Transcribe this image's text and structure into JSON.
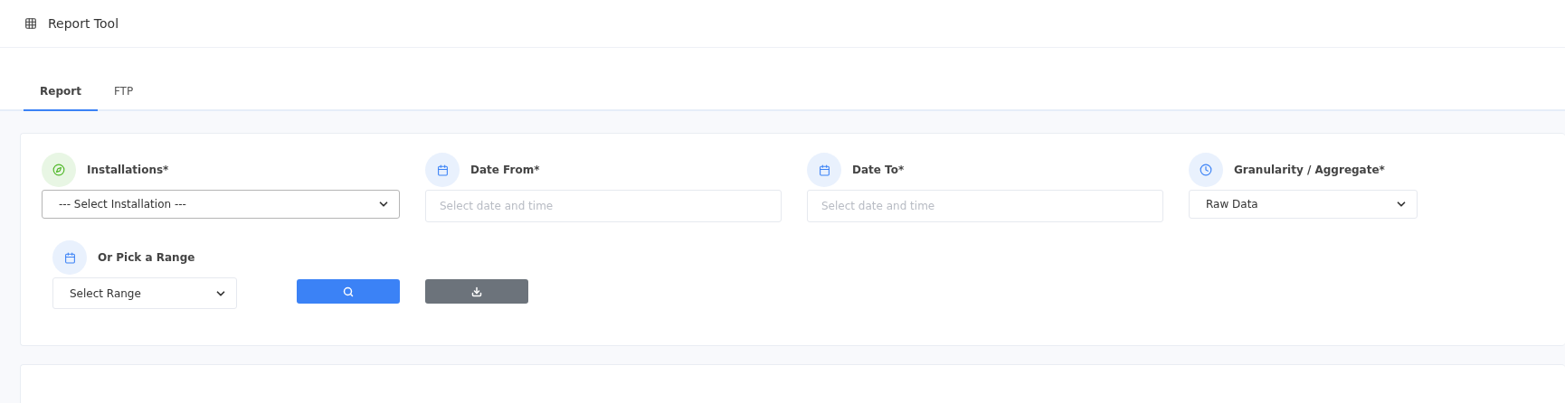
{
  "header": {
    "title": "Report Tool"
  },
  "tabs": [
    {
      "label": "Report",
      "selected": true
    },
    {
      "label": "FTP",
      "selected": false
    }
  ],
  "fields": [
    {
      "kind": "installation",
      "label": "Installations*",
      "value": "--- Select Installation ---",
      "emphasized": true
    },
    {
      "kind": "date",
      "label": "Date From*",
      "placeholder": "Select date and time"
    },
    {
      "kind": "date",
      "label": "Date To*",
      "placeholder": "Select date and time"
    },
    {
      "kind": "granularity",
      "label": "Granularity / Aggregate*",
      "value": "Raw Data",
      "emphasized": false
    }
  ],
  "range": {
    "label": "Or Pick a Range",
    "value": "Select Range"
  },
  "buttons": [
    {
      "kind": "search"
    },
    {
      "kind": "download"
    }
  ]
}
